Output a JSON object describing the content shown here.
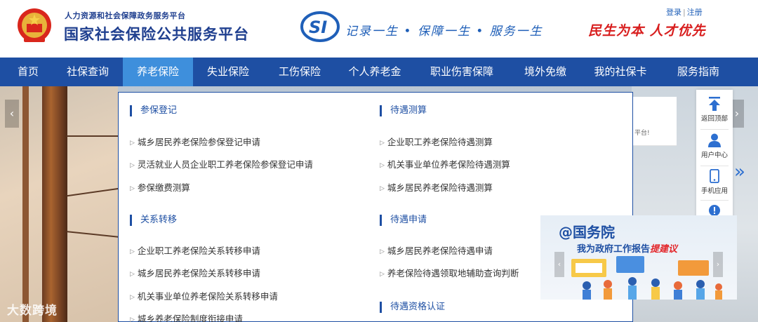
{
  "header": {
    "org_subtitle": "人力资源和社会保障政务服务平台",
    "org_title": "国家社会保险公共服务平台",
    "si_logo_icon": "si-logo-icon",
    "slogan": "记录一生 • 保障一生 • 服务一生",
    "motto": "民生为本 人才优先",
    "login": "登录",
    "divider": "|",
    "register": "注册"
  },
  "nav": {
    "items": [
      {
        "label": "首页"
      },
      {
        "label": "社保查询"
      },
      {
        "label": "养老保险",
        "active": true
      },
      {
        "label": "失业保险"
      },
      {
        "label": "工伤保险"
      },
      {
        "label": "个人养老金"
      },
      {
        "label": "职业伤害保障"
      },
      {
        "label": "境外免缴"
      },
      {
        "label": "我的社保卡"
      },
      {
        "label": "服务指南"
      }
    ]
  },
  "dropdown": {
    "sections": [
      {
        "title": "参保登记",
        "links": [
          "城乡居民养老保险参保登记申请",
          "灵活就业人员企业职工养老保险参保登记申请",
          "参保缴费测算"
        ]
      },
      {
        "title": "待遇测算",
        "links": [
          "企业职工养老保险待遇测算",
          "机关事业单位养老保险待遇测算",
          "城乡居民养老保险待遇测算"
        ]
      },
      {
        "title": "关系转移",
        "links": [
          "企业职工养老保险关系转移申请",
          "城乡居民养老保险关系转移申请",
          "机关事业单位养老保险关系转移申请",
          "城乡养老保险制度衔接申请"
        ]
      },
      {
        "title": "待遇申请",
        "links": [
          "城乡居民养老保险待遇申请",
          "养老保险待遇领取地辅助查询判断"
        ]
      },
      {
        "title": "待遇资格认证",
        "links": []
      }
    ]
  },
  "notice_card": {
    "text": "平台!"
  },
  "sidebar": {
    "items": [
      {
        "label": "返回顶部",
        "icon": "arrow-up-icon"
      },
      {
        "label": "用户中心",
        "icon": "user-icon"
      },
      {
        "label": "手机应用",
        "icon": "phone-icon"
      },
      {
        "label": "",
        "icon": "alert-icon"
      }
    ]
  },
  "promo": {
    "at_title": "@国务院",
    "subtitle_prefix": "我为政府工作报告",
    "subtitle_highlight": "提建议"
  },
  "carousel": {
    "prev": "‹",
    "next": "›",
    "more": "»"
  },
  "watermark": "大数跨境",
  "colors": {
    "brand_blue": "#1e4fa3",
    "nav_active": "#3e8fdc",
    "motto_red": "#d81e1e"
  }
}
